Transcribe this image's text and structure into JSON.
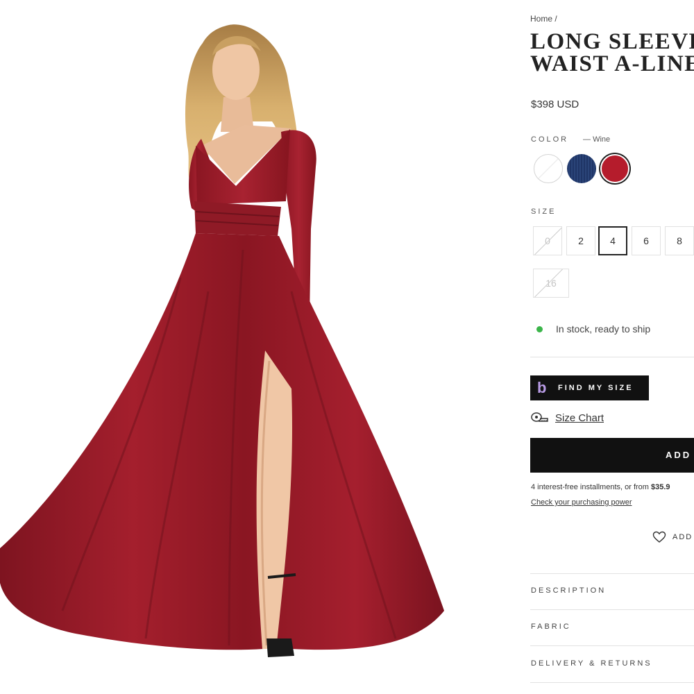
{
  "breadcrumb": {
    "home": "Home",
    "separator": "/"
  },
  "product": {
    "title_line1": "LONG SLEEVE",
    "title_line2": "WAIST A-LINE",
    "price": "$398 USD"
  },
  "color": {
    "label": "COLOR",
    "selected_prefix": "—",
    "selected": "Wine",
    "swatches": [
      {
        "name": "White",
        "hex": "#ffffff"
      },
      {
        "name": "Navy",
        "hex": "#1f3566"
      },
      {
        "name": "Wine",
        "hex": "#b51c2c"
      }
    ]
  },
  "size": {
    "label": "SIZE",
    "options": [
      "0",
      "2",
      "4",
      "6",
      "8",
      "16"
    ],
    "selected": "4",
    "unavailable": [
      "0",
      "16"
    ]
  },
  "stock": {
    "text": "In stock, ready to ship",
    "color": "#3bb54a"
  },
  "find_my_size": {
    "logo": "b",
    "label": "FIND MY SIZE"
  },
  "size_chart": {
    "label": "Size Chart"
  },
  "add_to_bag": {
    "label": "ADD"
  },
  "installments": {
    "text": "4 interest-free installments, or from",
    "amount": "$35.9",
    "link": "Check your purchasing power"
  },
  "wishlist": {
    "label": "ADD"
  },
  "accordions": [
    "DESCRIPTION",
    "FABRIC",
    "DELIVERY & RETURNS"
  ],
  "colors": {
    "dress": "#9e1c2a",
    "button": "#111111",
    "accent_logo": "#b99ce6"
  }
}
